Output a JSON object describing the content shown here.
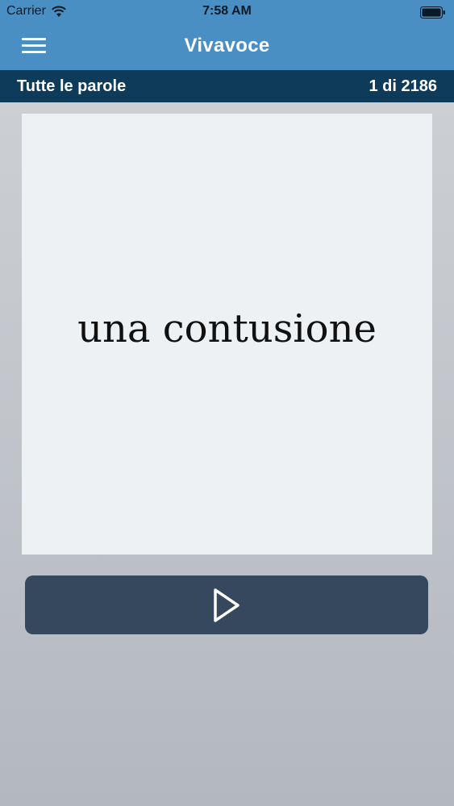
{
  "status_bar": {
    "carrier": "Carrier",
    "time": "7:58 AM"
  },
  "nav_bar": {
    "title": "Vivavoce",
    "menu_icon": "hamburger-menu-icon"
  },
  "sub_bar": {
    "category": "Tutte le parole",
    "counter": "1 di 2186"
  },
  "card": {
    "word": "una contusione"
  },
  "play_button": {
    "icon": "play-icon"
  },
  "colors": {
    "nav_blue": "#4a8fc4",
    "sub_bar_navy": "#0f3b5b",
    "card_bg": "#edf1f4",
    "button_bg": "#35485e"
  }
}
